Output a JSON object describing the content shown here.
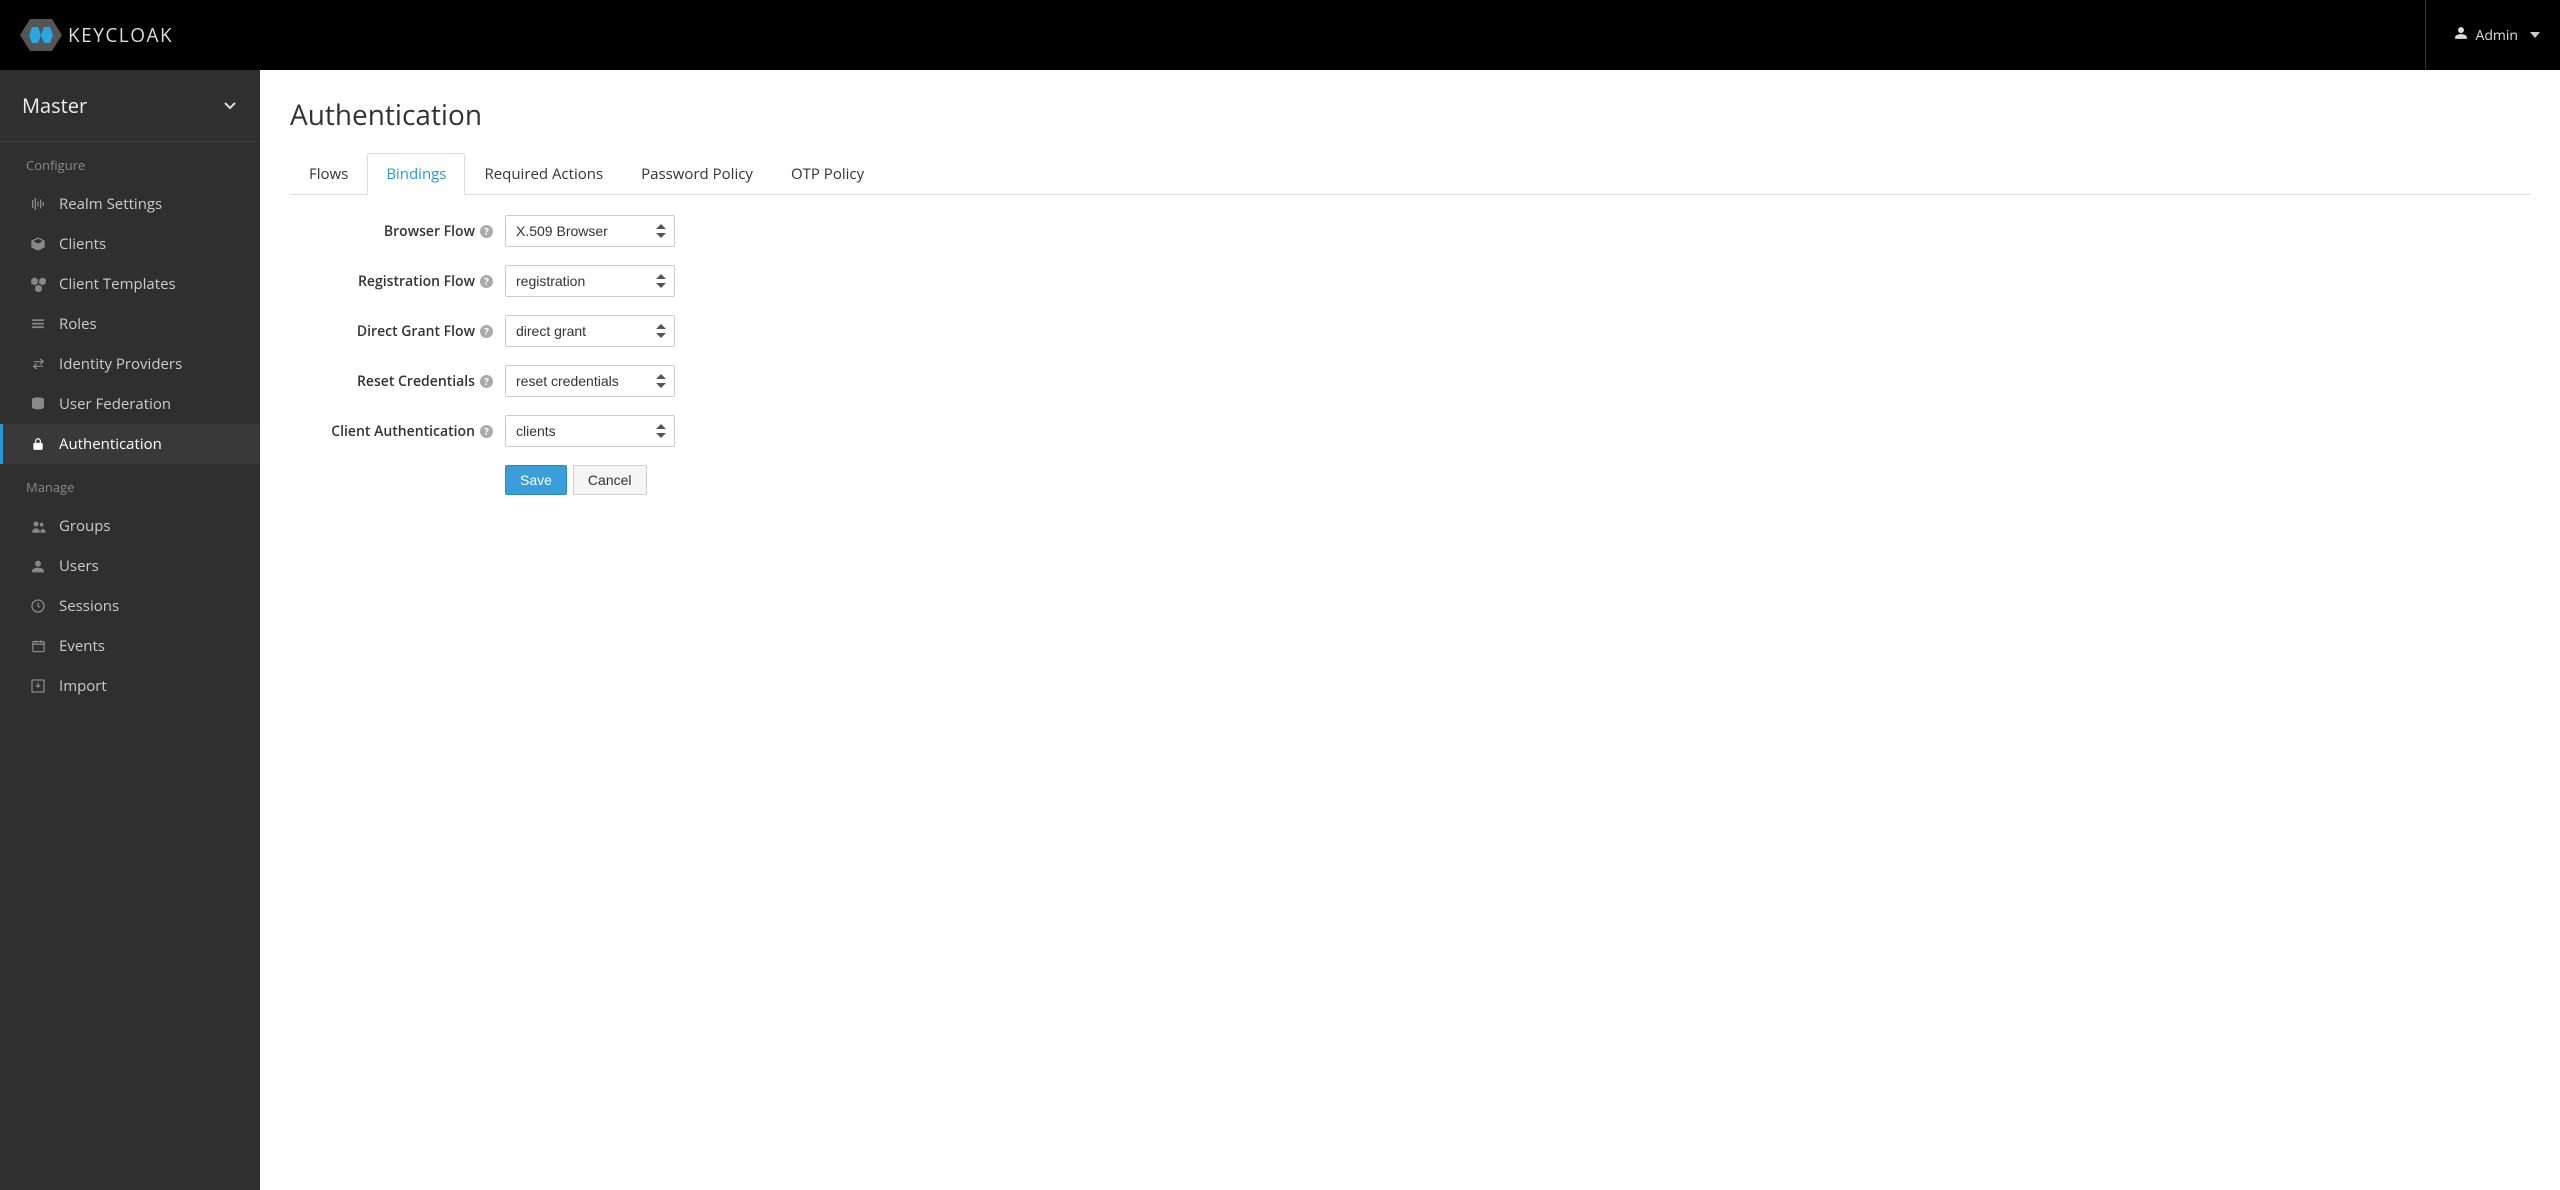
{
  "brand": {
    "name": "KEYCLOAK"
  },
  "header": {
    "user": "Admin"
  },
  "sidebar": {
    "realm": "Master",
    "sections": [
      {
        "title": "Configure",
        "items": [
          {
            "label": "Realm Settings",
            "icon": "sliders-icon",
            "active": false
          },
          {
            "label": "Clients",
            "icon": "cube-icon",
            "active": false
          },
          {
            "label": "Client Templates",
            "icon": "cubes-icon",
            "active": false
          },
          {
            "label": "Roles",
            "icon": "list-icon",
            "active": false
          },
          {
            "label": "Identity Providers",
            "icon": "exchange-icon",
            "active": false
          },
          {
            "label": "User Federation",
            "icon": "database-icon",
            "active": false
          },
          {
            "label": "Authentication",
            "icon": "lock-icon",
            "active": true
          }
        ]
      },
      {
        "title": "Manage",
        "items": [
          {
            "label": "Groups",
            "icon": "group-icon",
            "active": false
          },
          {
            "label": "Users",
            "icon": "user-icon",
            "active": false
          },
          {
            "label": "Sessions",
            "icon": "clock-icon",
            "active": false
          },
          {
            "label": "Events",
            "icon": "calendar-icon",
            "active": false
          },
          {
            "label": "Import",
            "icon": "import-icon",
            "active": false
          }
        ]
      }
    ]
  },
  "page": {
    "title": "Authentication",
    "tabs": [
      {
        "label": "Flows",
        "active": false
      },
      {
        "label": "Bindings",
        "active": true
      },
      {
        "label": "Required Actions",
        "active": false
      },
      {
        "label": "Password Policy",
        "active": false
      },
      {
        "label": "OTP Policy",
        "active": false
      }
    ],
    "form": {
      "fields": [
        {
          "label": "Browser Flow",
          "value": "X.509 Browser",
          "name": "browser-flow"
        },
        {
          "label": "Registration Flow",
          "value": "registration",
          "name": "registration-flow"
        },
        {
          "label": "Direct Grant Flow",
          "value": "direct grant",
          "name": "direct-grant-flow"
        },
        {
          "label": "Reset Credentials",
          "value": "reset credentials",
          "name": "reset-credentials"
        },
        {
          "label": "Client Authentication",
          "value": "clients",
          "name": "client-authentication"
        }
      ],
      "actions": {
        "save": "Save",
        "cancel": "Cancel"
      }
    }
  }
}
